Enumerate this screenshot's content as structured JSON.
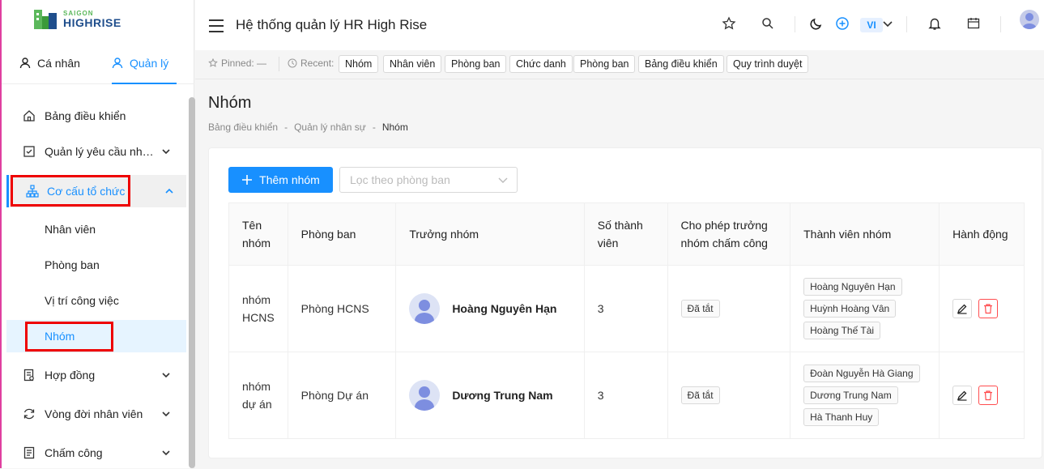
{
  "logo": {
    "line1": "SAIGON",
    "line2": "HIGHRISE"
  },
  "sidebar": {
    "tab_personal": "Cá nhân",
    "tab_manage": "Quản lý",
    "items": [
      {
        "label": "Bảng điều khiển",
        "icon": "home-icon"
      },
      {
        "label": "Quản lý yêu cầu nhân sự",
        "icon": "checkbox-icon"
      },
      {
        "label": "Cơ cấu tổ chức",
        "icon": "org-chart-icon"
      },
      {
        "label": "Hợp đồng",
        "icon": "contract-icon"
      },
      {
        "label": "Vòng đời nhân viên",
        "icon": "cycle-icon"
      },
      {
        "label": "Chấm công",
        "icon": "timesheet-icon"
      }
    ],
    "subitems": [
      "Nhân viên",
      "Phòng ban",
      "Vị trí công việc",
      "Nhóm"
    ]
  },
  "header": {
    "title": "Hệ thống quản lý HR High Rise",
    "lang": "VI"
  },
  "recent": {
    "pinned_label": "Pinned: —",
    "recent_label": "Recent:",
    "chips": [
      "Nhóm",
      "Nhân viên",
      "Phòng ban",
      "Chức danh",
      "Phòng ban",
      "Bảng điều khiển",
      "Quy trình duyệt"
    ]
  },
  "page": {
    "title": "Nhóm",
    "breadcrumb": [
      "Bảng điều khiển",
      "-",
      "Quản lý nhân sự",
      "-",
      "Nhóm"
    ],
    "add_button": "Thêm nhóm",
    "filter_placeholder": "Lọc theo phòng ban"
  },
  "table": {
    "headers": [
      "Tên nhóm",
      "Phòng ban",
      "Trưởng nhóm",
      "Số thành viên",
      "Cho phép trưởng nhóm chấm công",
      "Thành viên nhóm",
      "Hành động"
    ],
    "rows": [
      {
        "name": "nhóm HCNS",
        "department": "Phòng HCNS",
        "leader": "Hoàng Nguyên Hạn",
        "count": "3",
        "allow": "Đã tắt",
        "members": [
          "Hoàng Nguyên Hạn",
          "Huỳnh Hoàng Vân",
          "Hoàng Thế Tài"
        ]
      },
      {
        "name": "nhóm dự án",
        "department": "Phòng Dự án",
        "leader": "Dương Trung Nam",
        "count": "3",
        "allow": "Đã tắt",
        "members": [
          "Đoàn Nguyễn Hà Giang",
          "Dương Trung Nam",
          "Hà Thanh Huy"
        ]
      }
    ]
  },
  "colors": {
    "accent": "#1890ff",
    "danger": "#ff4d4f",
    "highlight": "#e00000"
  }
}
